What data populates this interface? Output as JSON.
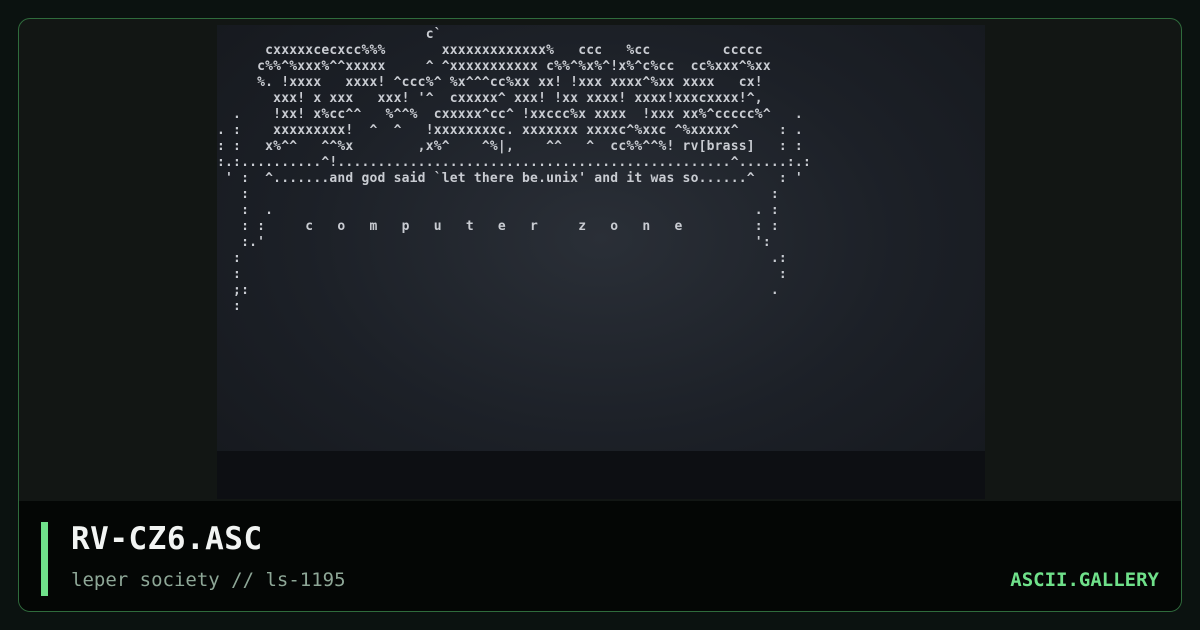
{
  "card": {
    "title": "RV-CZ6.ASC",
    "subtitle": "leper society // ls-1195",
    "brand": "ASCII.GALLERY",
    "accent_color": "#6fe08a"
  },
  "artwork": {
    "text": "                          c`\n      cxxxxxcecxcc%%%       xxxxxxxxxxxxx%   ccc   %cc         ccccc\n     c%%^%xxx%^^xxxxx     ^ ^xxxxxxxxxxx c%%^%x%^!x%^c%cc  cc%xxx^%xx\n     %. !xxxx   xxxx! ^ccc%^ %x^^^cc%xx xx! !xxx xxxx^%xx xxxx   cx!\n       xxx! x xxx   xxx! '^  cxxxxx^ xxx! !xx xxxx! xxxx!xxxcxxxx!^,\n  .    !xx! x%cc^^   %^^%  cxxxxx^cc^ !xxccc%x xxxx  !xxx xx%^ccccc%^   .\n. :    xxxxxxxxx!  ^  ^   !xxxxxxxxc. xxxxxxx xxxxc^%xxc ^%xxxxx^     : .\n: :   x%^^   ^^%x        ,x%^    ^%|,    ^^   ^  cc%%^^%! rv[brass]   : :\n:.:..........^!.................................................^......:.:\n ' :  ^.......and god said `let there be.unix' and it was so......^   : '\n   :                                                                 :\n   :  .                                                            . :\n   : :     c   o   m   p   u   t   e   r     z   o   n   e         : :\n   :.'                                                             ':\n  :                                                                  .:\n  :                                                                   :\n  ;:                                                                 .\n  :"
  }
}
